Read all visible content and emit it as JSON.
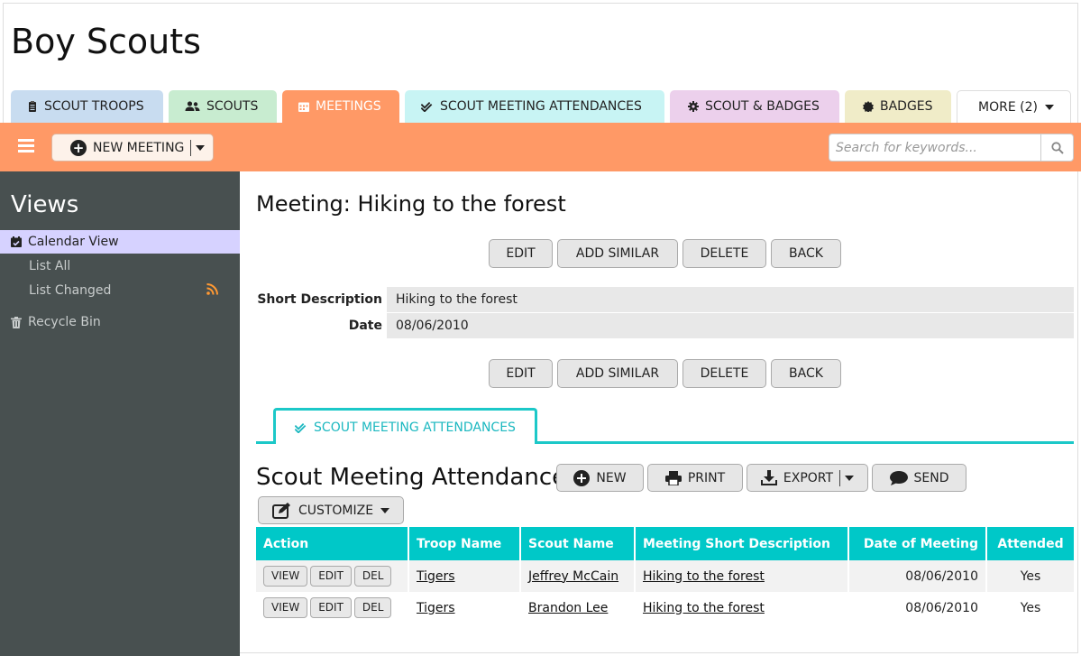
{
  "app": {
    "title": "Boy Scouts"
  },
  "tabs": [
    {
      "label": "SCOUT TROOPS",
      "icon": "clipboard-icon",
      "color": "#c8dcf0"
    },
    {
      "label": "SCOUTS",
      "icon": "users-icon",
      "color": "#c8ecd0"
    },
    {
      "label": "MEETINGS",
      "icon": "calendar-icon",
      "color": "#ff9966",
      "active": true
    },
    {
      "label": "SCOUT MEETING ATTENDANCES",
      "icon": "check-double-icon",
      "color": "#c8f4f4"
    },
    {
      "label": "SCOUT & BADGES",
      "icon": "gear-badge-icon",
      "color": "#ecd0ec"
    },
    {
      "label": "BADGES",
      "icon": "certificate-icon",
      "color": "#f0ecc8"
    },
    {
      "label": "MORE (2)",
      "icon": "caret-down-icon",
      "color": "#ffffff"
    }
  ],
  "toolbar": {
    "new_label": "NEW MEETING",
    "search_placeholder": "Search for keywords..."
  },
  "sidebar": {
    "heading": "Views",
    "items": [
      {
        "label": "Calendar View",
        "icon": "calendar-check-icon"
      },
      {
        "label": "List All"
      },
      {
        "label": "List Changed",
        "icon": "rss-icon"
      },
      {
        "label": "Recycle Bin",
        "icon": "trash-icon"
      }
    ]
  },
  "record": {
    "title": "Meeting: Hiking to the forest",
    "actions": [
      "EDIT",
      "ADD SIMILAR",
      "DELETE",
      "BACK"
    ],
    "fields": [
      {
        "label": "Short Description",
        "value": "Hiking to the forest"
      },
      {
        "label": "Date",
        "value": "08/06/2010"
      }
    ]
  },
  "subtab": {
    "label": "SCOUT MEETING ATTENDANCES"
  },
  "attendances": {
    "title": "Scout Meeting Attendances",
    "buttons": {
      "new": "NEW",
      "print": "PRINT",
      "export": "EXPORT",
      "send": "SEND",
      "customize": "CUSTOMIZE"
    },
    "columns": [
      "Action",
      "Troop Name",
      "Scout Name",
      "Meeting Short Description",
      "Date of Meeting",
      "Attended"
    ],
    "row_actions": [
      "VIEW",
      "EDIT",
      "DEL"
    ],
    "rows": [
      {
        "troop": "Tigers",
        "scout": "Jeffrey McCain",
        "meeting": "Hiking to the forest",
        "date": "08/06/2010",
        "attended": "Yes"
      },
      {
        "troop": "Tigers",
        "scout": "Brandon Lee",
        "meeting": "Hiking to the forest",
        "date": "08/06/2010",
        "attended": "Yes"
      }
    ]
  }
}
